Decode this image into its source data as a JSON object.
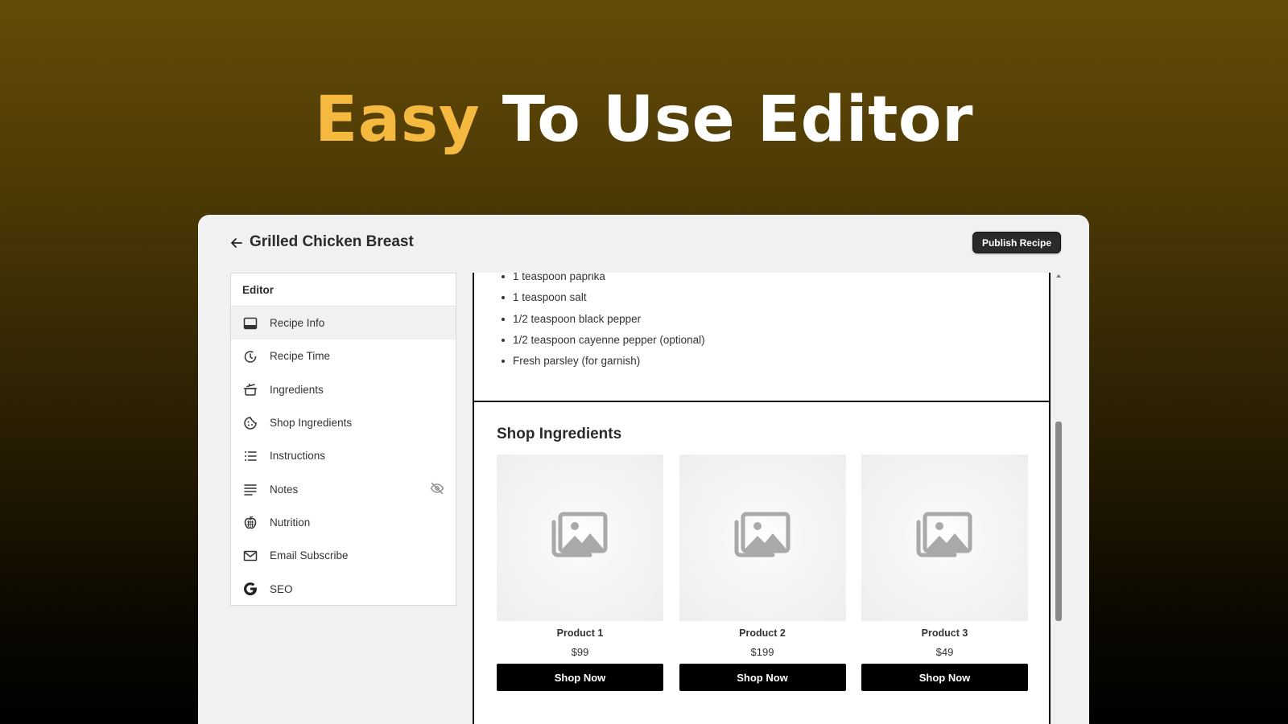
{
  "hero": {
    "accent": "Easy",
    "rest": "To Use Editor"
  },
  "topbar": {
    "title": "Grilled Chicken Breast",
    "publish_label": "Publish Recipe"
  },
  "sidebar": {
    "header": "Editor",
    "items": [
      {
        "label": "Recipe Info",
        "icon": "recipe-info-icon"
      },
      {
        "label": "Recipe Time",
        "icon": "timer-icon"
      },
      {
        "label": "Ingredients",
        "icon": "pot-icon"
      },
      {
        "label": "Shop Ingredients",
        "icon": "cookie-icon"
      },
      {
        "label": "Instructions",
        "icon": "list-icon"
      },
      {
        "label": "Notes",
        "icon": "notes-icon"
      },
      {
        "label": "Nutrition",
        "icon": "apple-icon"
      },
      {
        "label": "Email Subscribe",
        "icon": "mail-icon"
      },
      {
        "label": "SEO",
        "icon": "google-icon"
      }
    ]
  },
  "ingredients": [
    "1 teaspoon paprika",
    "1 teaspoon salt",
    "1/2 teaspoon black pepper",
    "1/2 teaspoon cayenne pepper (optional)",
    "Fresh parsley (for garnish)"
  ],
  "shop": {
    "title": "Shop Ingredients",
    "products": [
      {
        "name": "Product 1",
        "price": "$99",
        "button": "Shop Now"
      },
      {
        "name": "Product 2",
        "price": "$199",
        "button": "Shop Now"
      },
      {
        "name": "Product 3",
        "price": "$49",
        "button": "Shop Now"
      }
    ]
  },
  "colors": {
    "accent": "#f6b940",
    "button": "#000000",
    "publish": "#2a2a2a"
  }
}
